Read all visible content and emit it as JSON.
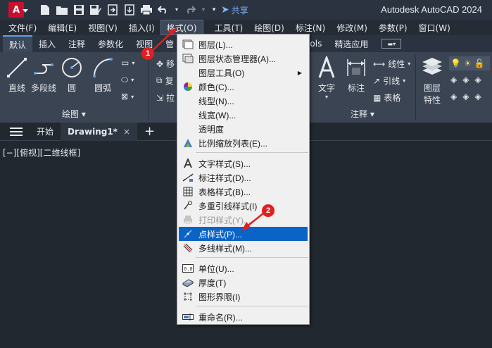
{
  "titlebar": {
    "logo_letter": "A",
    "share_label": "共享",
    "app_title": "Autodesk AutoCAD 2024"
  },
  "menubar": {
    "items": [
      "文件(F)",
      "编辑(E)",
      "视图(V)",
      "插入(I)",
      "格式(O)",
      "工具(T)",
      "绘图(D)",
      "标注(N)",
      "修改(M)",
      "参数(P)",
      "窗口(W)"
    ]
  },
  "ribbon_tabs": {
    "items": [
      "默认",
      "插入",
      "注释",
      "参数化",
      "视图",
      "管",
      "Express Tools",
      "精选应用"
    ]
  },
  "ribbon": {
    "draw_panel": {
      "title": "绘图",
      "line": "直线",
      "polyline": "多段线",
      "circle": "圆",
      "arc": "圆弧"
    },
    "modify_partial": [
      "移",
      "复",
      "拉"
    ],
    "annotation_panel": {
      "title": "注释",
      "text": "文字",
      "dimension": "标注",
      "linear": "线性",
      "leader": "引线",
      "table": "表格"
    },
    "layers_panel": {
      "properties_line1": "图层",
      "properties_line2": "特性"
    }
  },
  "doctabs": {
    "start": "开始",
    "drawing": "Drawing1*",
    "close": "×",
    "add": "+"
  },
  "viewport_label": "[−][俯视][二维线框]",
  "format_menu": {
    "items": [
      {
        "label": "图层(L)...",
        "icon": "layer-icon"
      },
      {
        "label": "图层状态管理器(A)...",
        "icon": "layer-state-icon"
      },
      {
        "label": "图层工具(O)",
        "icon": "",
        "submenu": true
      },
      {
        "label": "颜色(C)...",
        "icon": "color-wheel-icon"
      },
      {
        "label": "线型(N)...",
        "icon": ""
      },
      {
        "label": "线宽(W)...",
        "icon": ""
      },
      {
        "label": "透明度",
        "icon": ""
      },
      {
        "label": "比例缩放列表(E)...",
        "icon": "scale-list-icon"
      },
      {
        "label": "文字样式(S)...",
        "icon": "text-style-icon"
      },
      {
        "label": "标注样式(D)...",
        "icon": "dim-style-icon"
      },
      {
        "label": "表格样式(B)...",
        "icon": "table-style-icon"
      },
      {
        "label": "多重引线样式(I)",
        "icon": "mleader-style-icon"
      },
      {
        "label": "打印样式(Y)...",
        "icon": "plot-style-icon",
        "disabled": true
      },
      {
        "label": "点样式(P)...",
        "icon": "point-style-icon",
        "highlight": true
      },
      {
        "label": "多线样式(M)...",
        "icon": "mline-style-icon"
      },
      {
        "label": "单位(U)...",
        "icon": "units-icon"
      },
      {
        "label": "厚度(T)",
        "icon": "thickness-icon"
      },
      {
        "label": "图形界限(I)",
        "icon": "limits-icon"
      },
      {
        "label": "重命名(R)...",
        "icon": "rename-icon"
      }
    ]
  },
  "callouts": [
    "1",
    "2"
  ],
  "colors": {
    "accent_highlight": "#0a64c8",
    "callout": "#e02020",
    "share": "#7ab8ff"
  }
}
